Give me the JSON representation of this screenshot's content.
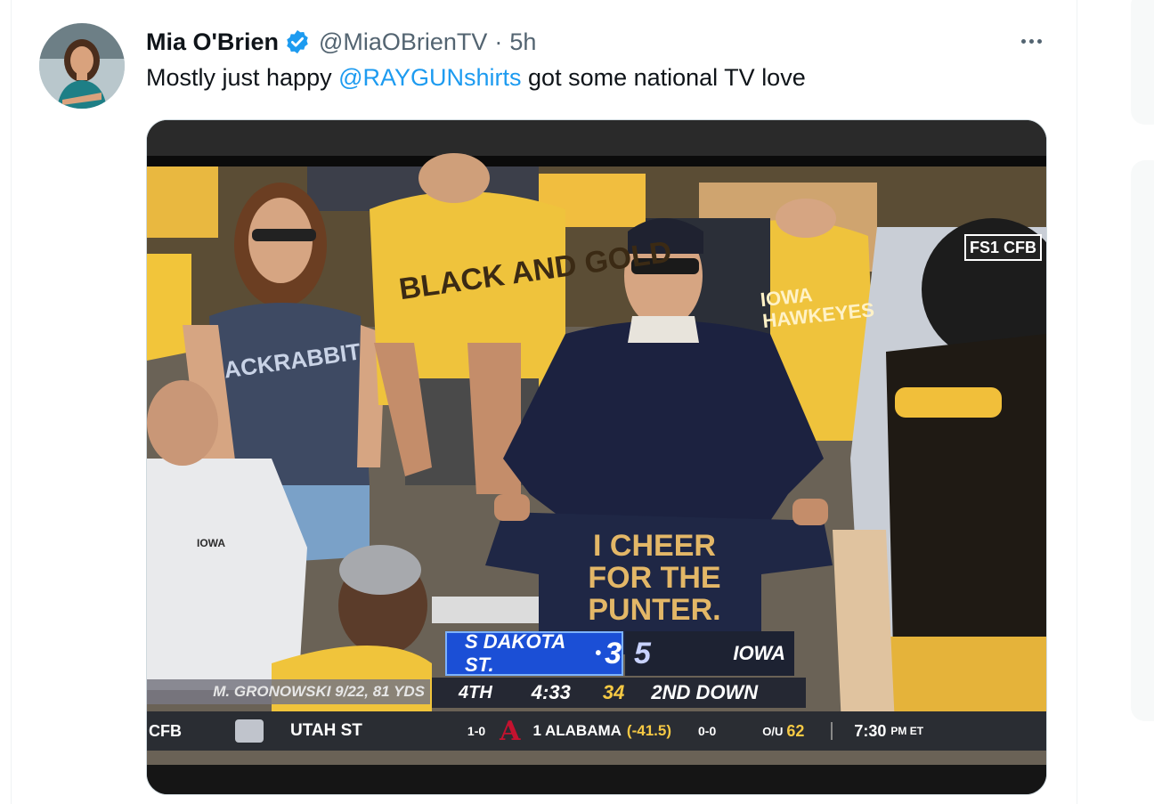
{
  "tweet": {
    "author_name": "Mia O'Brien",
    "handle": "@MiaOBrienTV",
    "separator": "·",
    "time": "5h",
    "text_before": "Mostly just happy ",
    "mention": "@RAYGUNshirts",
    "text_after": " got some national TV love",
    "more_icon": "more-icon",
    "verified_icon": "verified-badge-icon"
  },
  "media": {
    "network_bug": "FS1 CFB",
    "shirt_lines": [
      "I CHEER",
      "FOR THE",
      "PUNTER."
    ],
    "fan_shirt_left": "ACKRABBIT",
    "fan_shirt_center": "BLACK AND GOLD",
    "fan_shirt_right": "IOWA HAWKEYES",
    "polo_logo": "IOWA",
    "scorebug": {
      "away_team": "S DAKOTA ST.",
      "away_score": "3",
      "home_score": "5",
      "home_team": "IOWA",
      "quarter": "4TH",
      "clock": "4:33",
      "play_clock": "34",
      "down": "2ND DOWN",
      "player_note": "M. GRONOWSKI 9/22, 81 YDS"
    },
    "ticker": {
      "league": "CFB",
      "team1": "UTAH ST",
      "team1_record": "1-0",
      "team2": "1 ALABAMA",
      "spread": "(-41.5)",
      "team2_record": "0-0",
      "over_under_label": "O/U",
      "over_under": "62",
      "kickoff": "7:30",
      "kickoff_suffix": "PM ET"
    }
  },
  "colors": {
    "link": "#1d9bf0",
    "muted": "#536471",
    "iowa_gold": "#f6c944",
    "scorebug_blue": "#1b4fd6"
  }
}
